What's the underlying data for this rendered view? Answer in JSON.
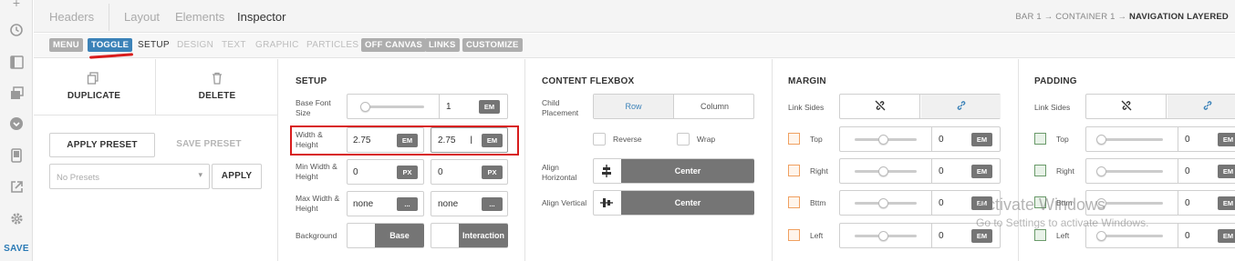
{
  "rail": {
    "icons": [
      "plus-icon",
      "history-icon",
      "layout-icon",
      "layers-icon",
      "circle-chevron-icon",
      "device-icon",
      "export-icon",
      "settings-icon"
    ],
    "save_label": "SAVE"
  },
  "topbar": {
    "tabs": [
      "Headers",
      "Layout",
      "Elements",
      "Inspector"
    ],
    "active_tab": "Inspector",
    "breadcrumb": {
      "items": [
        "BAR 1",
        "CONTAINER 1"
      ],
      "current": "NAVIGATION LAYERED",
      "separator": "→"
    }
  },
  "subbar": {
    "pills_left": [
      "MENU",
      "TOGGLE"
    ],
    "active_pill": "TOGGLE",
    "subtabs": [
      "SETUP",
      "DESIGN",
      "TEXT",
      "GRAPHIC",
      "PARTICLES"
    ],
    "active_subtab": "SETUP",
    "pills_right": [
      "OFF CANVAS",
      "LINKS",
      "CUSTOMIZE"
    ]
  },
  "actions": {
    "duplicate": "DUPLICATE",
    "delete": "DELETE",
    "apply_preset": "APPLY PRESET",
    "save_preset": "SAVE PRESET",
    "presets_placeholder": "No Presets",
    "apply": "APPLY"
  },
  "setup": {
    "title": "SETUP",
    "base_font_label": "Base Font Size",
    "base_font_value": "1",
    "base_font_unit": "EM",
    "base_font_slider": 0.05,
    "wh_label": "Width & Height",
    "width_value": "2.75",
    "width_unit": "EM",
    "height_value": "2.75",
    "height_unit": "EM",
    "min_label": "Min Width & Height",
    "min_w": "0",
    "min_w_unit": "PX",
    "min_h": "0",
    "min_h_unit": "PX",
    "max_label": "Max Width & Height",
    "max_w": "none",
    "max_w_unit": "...",
    "max_h": "none",
    "max_h_unit": "...",
    "bg_label": "Background",
    "bg_base": "Base",
    "bg_interaction": "Interaction"
  },
  "flexbox": {
    "title": "CONTENT FLEXBOX",
    "child_label": "Child Placement",
    "row": "Row",
    "column": "Column",
    "active_direction": "Row",
    "reverse": "Reverse",
    "wrap": "Wrap",
    "align_h_label": "Align Horizontal",
    "align_h_value": "Center",
    "align_v_label": "Align Vertical",
    "align_v_value": "Center"
  },
  "margin": {
    "title": "MARGIN",
    "link_label": "Link Sides",
    "sides": [
      {
        "label": "Top",
        "value": "0",
        "unit": "EM",
        "slider": 0.45
      },
      {
        "label": "Right",
        "value": "0",
        "unit": "EM",
        "slider": 0.45
      },
      {
        "label": "Bttm",
        "value": "0",
        "unit": "EM",
        "slider": 0.45
      },
      {
        "label": "Left",
        "value": "0",
        "unit": "EM",
        "slider": 0.45
      }
    ]
  },
  "padding": {
    "title": "PADDING",
    "link_label": "Link Sides",
    "sides": [
      {
        "label": "Top",
        "value": "0",
        "unit": "EM",
        "slider": 0.0
      },
      {
        "label": "Right",
        "value": "0",
        "unit": "EM",
        "slider": 0.0
      },
      {
        "label": "Bttm",
        "value": "0",
        "unit": "EM",
        "slider": 0.0
      },
      {
        "label": "Left",
        "value": "0",
        "unit": "EM",
        "slider": 0.0
      }
    ]
  },
  "watermark": {
    "line1": "Activate Windows",
    "line2": "Go to Settings to activate Windows."
  },
  "colors": {
    "accent": "#3b82b8",
    "highlight": "#d81c1c",
    "dark_button": "#757575"
  }
}
